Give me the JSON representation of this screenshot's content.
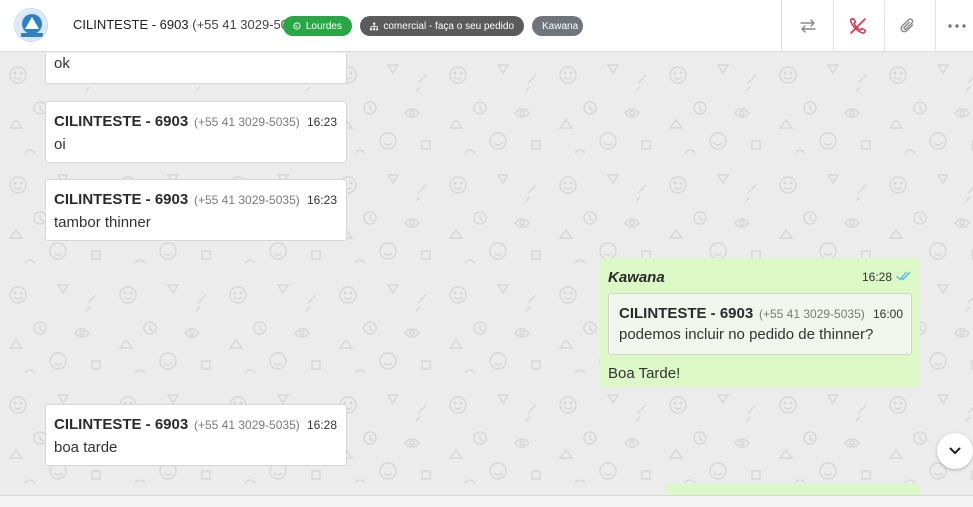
{
  "header": {
    "contact_name": "CILINTESTE - 6903",
    "contact_phone": "(+55 41 3029-5035)",
    "tags": {
      "whatsapp": "Lourdes",
      "queue": "comercial - faça o seu pedido",
      "user": "Kawana"
    },
    "icons": [
      "transfer-icon",
      "hangup-icon",
      "attachment-icon",
      "more-options-icon"
    ],
    "colors": {
      "whatsapp_tag": "#28a745",
      "queue_tag": "#5b5b5b",
      "user_tag": "#6e757c",
      "hangup": "#d9324b"
    }
  },
  "messages": [
    {
      "text": "ok"
    },
    {
      "sender": "CILINTESTE - 6903",
      "phone": "(+55 41 3029-5035)",
      "time": "16:23",
      "text": "oi"
    },
    {
      "sender": "CILINTESTE - 6903",
      "phone": "(+55 41 3029-5035)",
      "time": "16:23",
      "text": "tambor thinner"
    },
    {
      "author": "Kawana",
      "time": "16:28",
      "status": "read",
      "quote": {
        "sender": "CILINTESTE - 6903",
        "phone": "(+55 41 3029-5035)",
        "time": "16:00",
        "text": "podemos incluir no pedido de thinner?"
      },
      "text": "Boa Tarde!"
    },
    {
      "sender": "CILINTESTE - 6903",
      "phone": "(+55 41 3029-5035)",
      "time": "16:28",
      "text": "boa tarde"
    }
  ],
  "colors": {
    "incoming_bubble": "#ffffff",
    "outgoing_bubble": "#dcf8c6",
    "chat_background": "#ececec",
    "read_ticks": "#4fb6ec"
  }
}
